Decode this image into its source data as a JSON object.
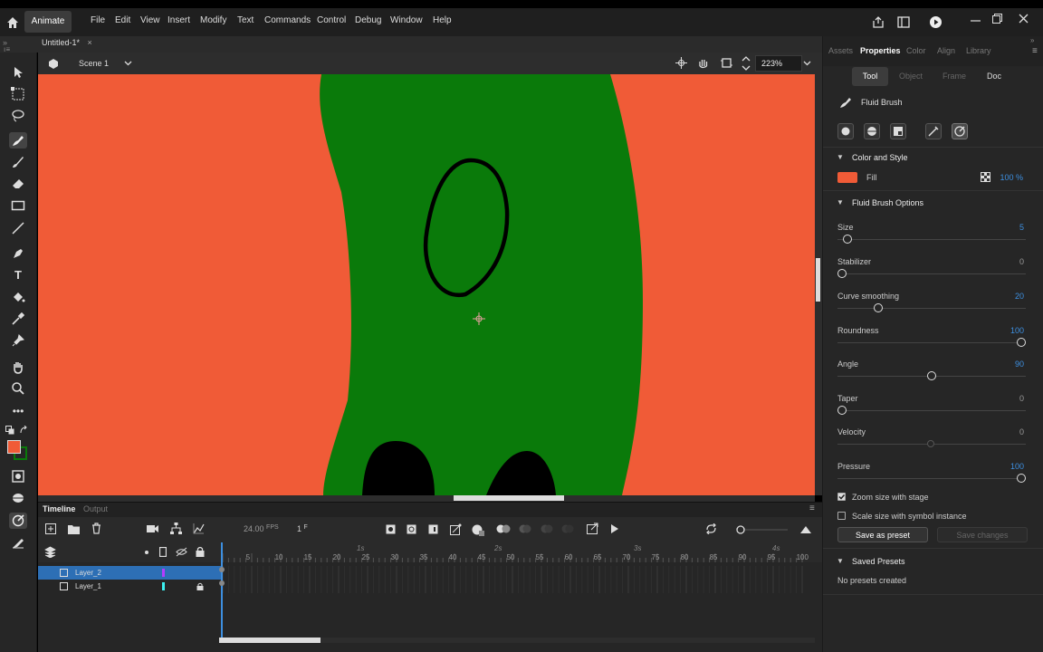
{
  "app": {
    "name": "Animate"
  },
  "menu": [
    "File",
    "Edit",
    "View",
    "Insert",
    "Modify",
    "Text",
    "Commands",
    "Control",
    "Debug",
    "Window",
    "Help"
  ],
  "document": {
    "tab_title": "Untitled-1*",
    "close": "×",
    "scene": "Scene 1",
    "zoom": "223%"
  },
  "timeline": {
    "tabs": [
      "Timeline",
      "Output"
    ],
    "fps_value": "24.00",
    "fps_unit": "FPS",
    "frame_value": "1",
    "frame_unit": "F",
    "seconds": [
      "1s",
      "2s",
      "3s",
      "4s"
    ],
    "frame_numbers": [
      "5",
      "10",
      "15",
      "20",
      "25",
      "30",
      "35",
      "40",
      "45",
      "50",
      "55",
      "60",
      "65",
      "70",
      "75",
      "80",
      "85",
      "90",
      "95",
      "100"
    ],
    "layers": [
      {
        "name": "Layer_2",
        "color": "#b43cff",
        "selected": true
      },
      {
        "name": "Layer_1",
        "color": "#3cf0f0",
        "selected": false
      }
    ]
  },
  "panel": {
    "tabs": [
      "Assets",
      "Properties",
      "Color",
      "Align",
      "Library"
    ],
    "active_tab": "Properties",
    "subtabs": [
      "Tool",
      "Object",
      "Frame",
      "Doc"
    ],
    "tool_name": "Fluid Brush",
    "color_section": {
      "title": "Color and Style",
      "fill_label": "Fill",
      "fill_color": "#f05b37",
      "opacity": "100 %"
    },
    "options_section": {
      "title": "Fluid Brush Options",
      "params": [
        {
          "label": "Size",
          "value": "5",
          "pos": 0.03
        },
        {
          "label": "Stabilizer",
          "value": "0",
          "pos": 0.0
        },
        {
          "label": "Curve smoothing",
          "value": "20",
          "pos": 0.2
        },
        {
          "label": "Roundness",
          "value": "100",
          "pos": 1.0
        },
        {
          "label": "Angle",
          "value": "90",
          "pos": 0.5
        },
        {
          "label": "Taper",
          "value": "0",
          "pos": 0.0
        },
        {
          "label": "Velocity",
          "value": "0",
          "pos": 0.5,
          "disabled": true
        },
        {
          "label": "Pressure",
          "value": "100",
          "pos": 1.0
        }
      ]
    },
    "zoom_size": {
      "label": "Zoom size with stage",
      "checked": true
    },
    "scale_size": {
      "label": "Scale size with symbol instance",
      "checked": false
    },
    "save_preset": "Save as preset",
    "save_changes": "Save changes",
    "saved_presets": {
      "title": "Saved Presets",
      "empty": "No presets created"
    }
  },
  "colors": {
    "stage_bg": "#f05b37",
    "shape_green": "#0a7a0a",
    "accent": "#3d8fe0"
  }
}
